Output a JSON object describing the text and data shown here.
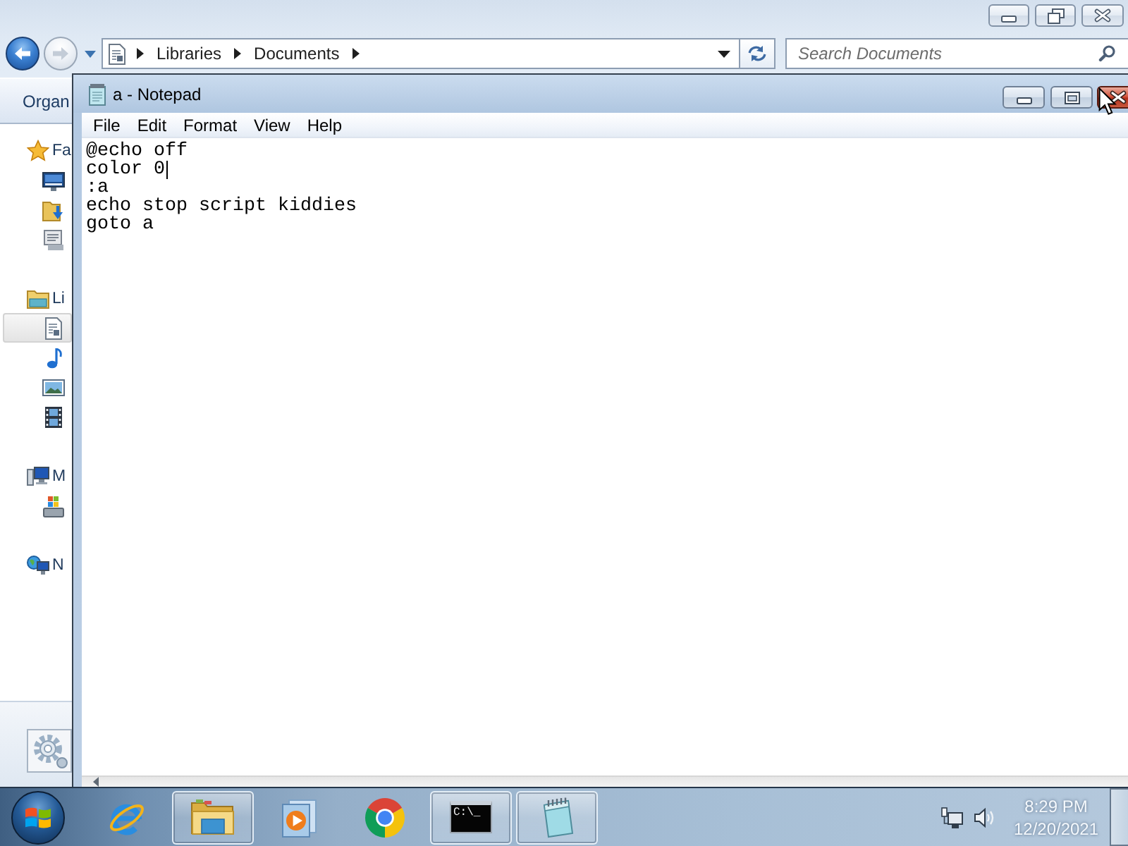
{
  "explorer": {
    "window_buttons": [
      {
        "kind": "minimize"
      },
      {
        "kind": "restore"
      },
      {
        "kind": "close"
      }
    ],
    "navigation": {
      "back": {
        "disabled": false
      },
      "forward": {
        "disabled": true
      }
    },
    "address_bar": {
      "segments": [
        "Libraries",
        "Documents"
      ]
    },
    "search": {
      "placeholder": "Search Documents"
    },
    "toolbar": {
      "organize": "Organ"
    },
    "sidebar": {
      "items": [
        {
          "kind": "favorites",
          "label": "Fa",
          "selected": false,
          "children": [
            {
              "kind": "desktop",
              "selected": false
            },
            {
              "kind": "downloads",
              "selected": false
            },
            {
              "kind": "recent",
              "selected": false
            }
          ]
        },
        {
          "kind": "libraries",
          "label": "Li",
          "selected": false,
          "children": [
            {
              "kind": "documents",
              "selected": true
            },
            {
              "kind": "music",
              "selected": false
            },
            {
              "kind": "pictures",
              "selected": false
            },
            {
              "kind": "videos",
              "selected": false
            }
          ]
        },
        {
          "kind": "computer",
          "label": "M",
          "selected": false,
          "children": [
            {
              "kind": "disk",
              "selected": false
            }
          ]
        },
        {
          "kind": "network",
          "label": "N",
          "selected": false
        }
      ]
    }
  },
  "notepad": {
    "title": "a - Notepad",
    "window_buttons": [
      {
        "kind": "minimize",
        "hovered": false
      },
      {
        "kind": "maximize",
        "hovered": false
      },
      {
        "kind": "close",
        "hovered": true
      }
    ],
    "menu": [
      "File",
      "Edit",
      "Format",
      "View",
      "Help"
    ],
    "lines": [
      {
        "text": "@echo off",
        "caret": false
      },
      {
        "text": "color 0",
        "caret": true
      },
      {
        "text": ":a",
        "caret": false
      },
      {
        "text": "echo stop script kiddies",
        "caret": false
      },
      {
        "text": "goto a",
        "caret": false
      }
    ]
  },
  "taskbar": {
    "items": [
      {
        "kind": "e-logo",
        "running": false
      },
      {
        "kind": "folder",
        "running": true
      },
      {
        "kind": "player",
        "running": false
      },
      {
        "kind": "ring-logo",
        "running": false
      },
      {
        "kind": "terminal",
        "running": true,
        "icon_text": "C:\\_"
      },
      {
        "kind": "notepad",
        "running": true
      }
    ],
    "clock": {
      "time": "8:29 PM",
      "date": "12/20/2021"
    }
  }
}
